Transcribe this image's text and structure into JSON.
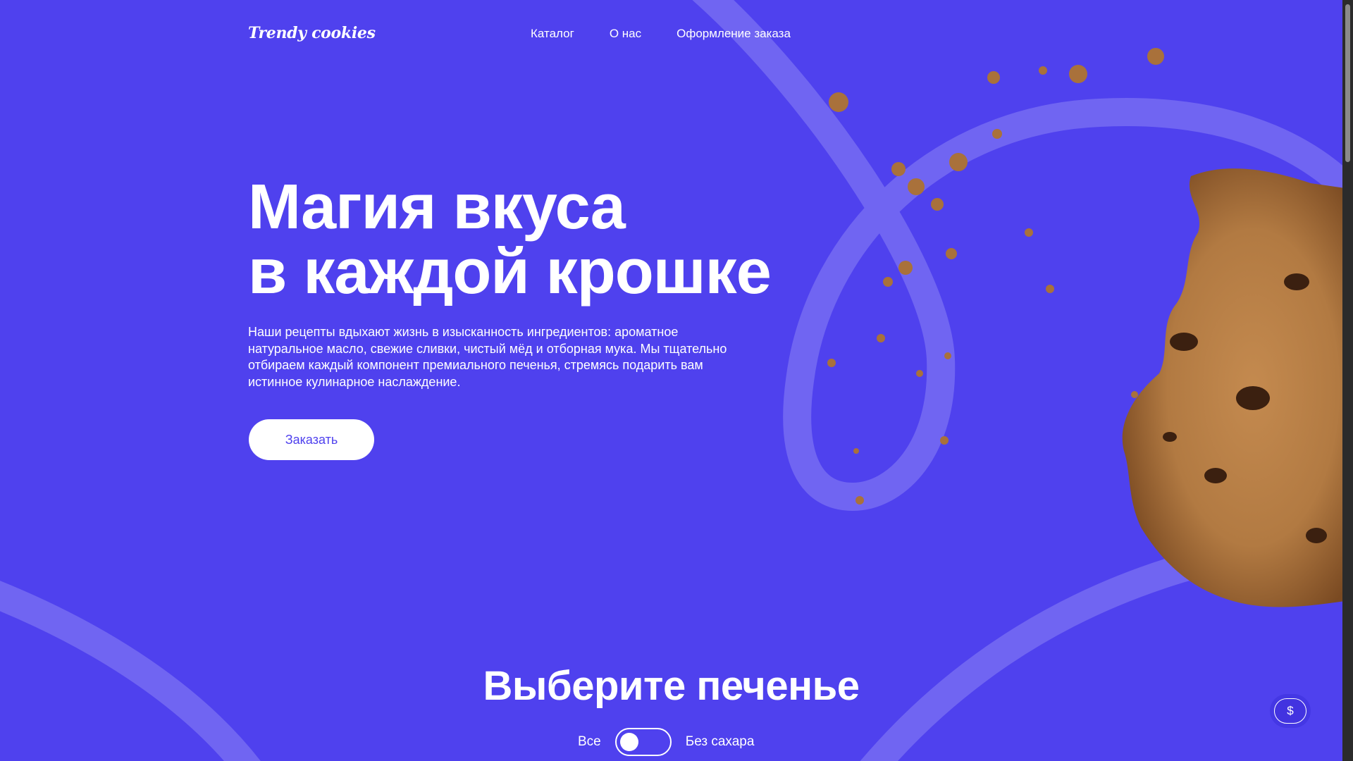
{
  "header": {
    "logo": "Trendy cookies",
    "nav": [
      "Каталог",
      "О нас",
      "Оформление заказа"
    ]
  },
  "hero": {
    "title_line1": "Магия вкуса",
    "title_line2": "в каждой крошке",
    "text": "Наши рецепты вдыхают жизнь в изысканность ингредиентов: ароматное натуральное масло, свежие сливки, чистый мёд и отборная мука. Мы тщательно отбираем каждый компонент премиального печенья, стремясь подарить вам истинное кулинарное наслаждение.",
    "order_button": "Заказать"
  },
  "catalog": {
    "title": "Выберите печенье",
    "filter_all": "Все",
    "filter_sugar_free": "Без сахара",
    "sugar_free_on": false
  },
  "currency_button": "$",
  "colors": {
    "background": "#4f41ee",
    "ribbon": "#7065f2",
    "cookie": "#b27a42",
    "text": "#ffffff"
  },
  "icons": {
    "currency": "dollar-icon",
    "decor": "cookie-image"
  }
}
